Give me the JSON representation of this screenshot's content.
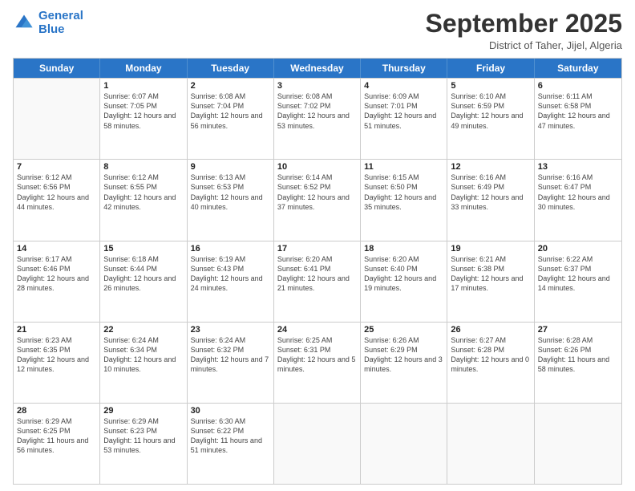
{
  "logo": {
    "line1": "General",
    "line2": "Blue"
  },
  "header": {
    "month": "September 2025",
    "location": "District of Taher, Jijel, Algeria"
  },
  "weekdays": [
    "Sunday",
    "Monday",
    "Tuesday",
    "Wednesday",
    "Thursday",
    "Friday",
    "Saturday"
  ],
  "rows": [
    [
      {
        "day": "",
        "sunrise": "",
        "sunset": "",
        "daylight": ""
      },
      {
        "day": "1",
        "sunrise": "Sunrise: 6:07 AM",
        "sunset": "Sunset: 7:05 PM",
        "daylight": "Daylight: 12 hours and 58 minutes."
      },
      {
        "day": "2",
        "sunrise": "Sunrise: 6:08 AM",
        "sunset": "Sunset: 7:04 PM",
        "daylight": "Daylight: 12 hours and 56 minutes."
      },
      {
        "day": "3",
        "sunrise": "Sunrise: 6:08 AM",
        "sunset": "Sunset: 7:02 PM",
        "daylight": "Daylight: 12 hours and 53 minutes."
      },
      {
        "day": "4",
        "sunrise": "Sunrise: 6:09 AM",
        "sunset": "Sunset: 7:01 PM",
        "daylight": "Daylight: 12 hours and 51 minutes."
      },
      {
        "day": "5",
        "sunrise": "Sunrise: 6:10 AM",
        "sunset": "Sunset: 6:59 PM",
        "daylight": "Daylight: 12 hours and 49 minutes."
      },
      {
        "day": "6",
        "sunrise": "Sunrise: 6:11 AM",
        "sunset": "Sunset: 6:58 PM",
        "daylight": "Daylight: 12 hours and 47 minutes."
      }
    ],
    [
      {
        "day": "7",
        "sunrise": "Sunrise: 6:12 AM",
        "sunset": "Sunset: 6:56 PM",
        "daylight": "Daylight: 12 hours and 44 minutes."
      },
      {
        "day": "8",
        "sunrise": "Sunrise: 6:12 AM",
        "sunset": "Sunset: 6:55 PM",
        "daylight": "Daylight: 12 hours and 42 minutes."
      },
      {
        "day": "9",
        "sunrise": "Sunrise: 6:13 AM",
        "sunset": "Sunset: 6:53 PM",
        "daylight": "Daylight: 12 hours and 40 minutes."
      },
      {
        "day": "10",
        "sunrise": "Sunrise: 6:14 AM",
        "sunset": "Sunset: 6:52 PM",
        "daylight": "Daylight: 12 hours and 37 minutes."
      },
      {
        "day": "11",
        "sunrise": "Sunrise: 6:15 AM",
        "sunset": "Sunset: 6:50 PM",
        "daylight": "Daylight: 12 hours and 35 minutes."
      },
      {
        "day": "12",
        "sunrise": "Sunrise: 6:16 AM",
        "sunset": "Sunset: 6:49 PM",
        "daylight": "Daylight: 12 hours and 33 minutes."
      },
      {
        "day": "13",
        "sunrise": "Sunrise: 6:16 AM",
        "sunset": "Sunset: 6:47 PM",
        "daylight": "Daylight: 12 hours and 30 minutes."
      }
    ],
    [
      {
        "day": "14",
        "sunrise": "Sunrise: 6:17 AM",
        "sunset": "Sunset: 6:46 PM",
        "daylight": "Daylight: 12 hours and 28 minutes."
      },
      {
        "day": "15",
        "sunrise": "Sunrise: 6:18 AM",
        "sunset": "Sunset: 6:44 PM",
        "daylight": "Daylight: 12 hours and 26 minutes."
      },
      {
        "day": "16",
        "sunrise": "Sunrise: 6:19 AM",
        "sunset": "Sunset: 6:43 PM",
        "daylight": "Daylight: 12 hours and 24 minutes."
      },
      {
        "day": "17",
        "sunrise": "Sunrise: 6:20 AM",
        "sunset": "Sunset: 6:41 PM",
        "daylight": "Daylight: 12 hours and 21 minutes."
      },
      {
        "day": "18",
        "sunrise": "Sunrise: 6:20 AM",
        "sunset": "Sunset: 6:40 PM",
        "daylight": "Daylight: 12 hours and 19 minutes."
      },
      {
        "day": "19",
        "sunrise": "Sunrise: 6:21 AM",
        "sunset": "Sunset: 6:38 PM",
        "daylight": "Daylight: 12 hours and 17 minutes."
      },
      {
        "day": "20",
        "sunrise": "Sunrise: 6:22 AM",
        "sunset": "Sunset: 6:37 PM",
        "daylight": "Daylight: 12 hours and 14 minutes."
      }
    ],
    [
      {
        "day": "21",
        "sunrise": "Sunrise: 6:23 AM",
        "sunset": "Sunset: 6:35 PM",
        "daylight": "Daylight: 12 hours and 12 minutes."
      },
      {
        "day": "22",
        "sunrise": "Sunrise: 6:24 AM",
        "sunset": "Sunset: 6:34 PM",
        "daylight": "Daylight: 12 hours and 10 minutes."
      },
      {
        "day": "23",
        "sunrise": "Sunrise: 6:24 AM",
        "sunset": "Sunset: 6:32 PM",
        "daylight": "Daylight: 12 hours and 7 minutes."
      },
      {
        "day": "24",
        "sunrise": "Sunrise: 6:25 AM",
        "sunset": "Sunset: 6:31 PM",
        "daylight": "Daylight: 12 hours and 5 minutes."
      },
      {
        "day": "25",
        "sunrise": "Sunrise: 6:26 AM",
        "sunset": "Sunset: 6:29 PM",
        "daylight": "Daylight: 12 hours and 3 minutes."
      },
      {
        "day": "26",
        "sunrise": "Sunrise: 6:27 AM",
        "sunset": "Sunset: 6:28 PM",
        "daylight": "Daylight: 12 hours and 0 minutes."
      },
      {
        "day": "27",
        "sunrise": "Sunrise: 6:28 AM",
        "sunset": "Sunset: 6:26 PM",
        "daylight": "Daylight: 11 hours and 58 minutes."
      }
    ],
    [
      {
        "day": "28",
        "sunrise": "Sunrise: 6:29 AM",
        "sunset": "Sunset: 6:25 PM",
        "daylight": "Daylight: 11 hours and 56 minutes."
      },
      {
        "day": "29",
        "sunrise": "Sunrise: 6:29 AM",
        "sunset": "Sunset: 6:23 PM",
        "daylight": "Daylight: 11 hours and 53 minutes."
      },
      {
        "day": "30",
        "sunrise": "Sunrise: 6:30 AM",
        "sunset": "Sunset: 6:22 PM",
        "daylight": "Daylight: 11 hours and 51 minutes."
      },
      {
        "day": "",
        "sunrise": "",
        "sunset": "",
        "daylight": ""
      },
      {
        "day": "",
        "sunrise": "",
        "sunset": "",
        "daylight": ""
      },
      {
        "day": "",
        "sunrise": "",
        "sunset": "",
        "daylight": ""
      },
      {
        "day": "",
        "sunrise": "",
        "sunset": "",
        "daylight": ""
      }
    ]
  ]
}
